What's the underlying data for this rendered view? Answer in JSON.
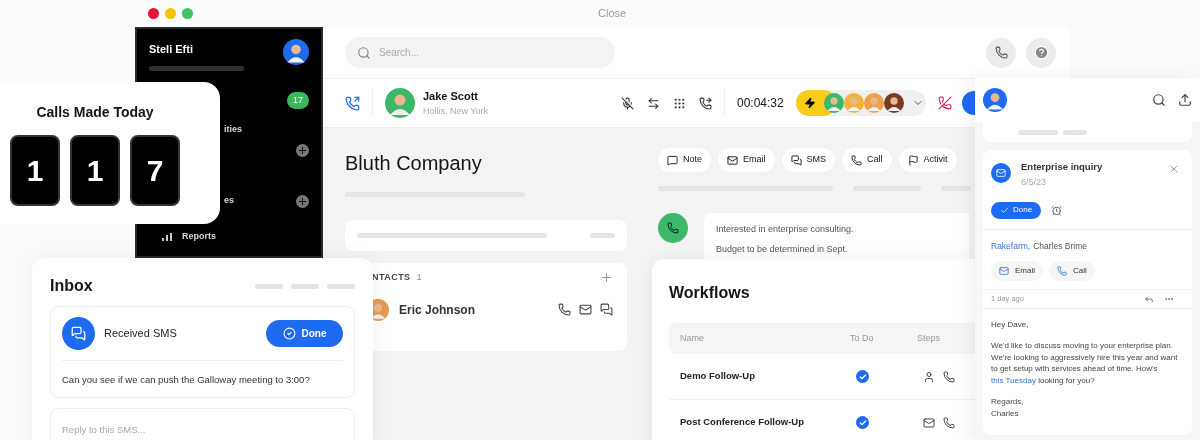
{
  "window": {
    "title": "Close"
  },
  "sidebar": {
    "user": "Steli Efti",
    "badge": "17",
    "items": [
      {
        "label": "ities",
        "kind": "text"
      },
      {
        "label": "es",
        "kind": "text"
      },
      {
        "label": "Reports",
        "kind": "reports"
      }
    ]
  },
  "calls_card": {
    "title": "Calls Made Today",
    "digits": [
      "1",
      "1",
      "7"
    ]
  },
  "search": {
    "placeholder": "Search..."
  },
  "call_bar": {
    "name": "Jake Scott",
    "location": "Hollis, New York",
    "timer": "00:04:32"
  },
  "company": {
    "name": "Bluth Company",
    "actions": [
      {
        "label": "Note",
        "kind": "note"
      },
      {
        "label": "Email",
        "kind": "email"
      },
      {
        "label": "SMS",
        "kind": "sms"
      },
      {
        "label": "Call",
        "kind": "call"
      },
      {
        "label": "Activit",
        "kind": "activity"
      }
    ]
  },
  "timeline": {
    "lines": [
      "Interested in enterprise consulting.",
      "Budget to be determined in Sept."
    ]
  },
  "contacts": {
    "heading": "NTACTS",
    "count": "1",
    "people": [
      {
        "name": "Eric Johnson"
      }
    ]
  },
  "inbox": {
    "title": "Inbox",
    "item": {
      "title": "Received SMS",
      "action": "Done",
      "message": "Can you see if we can push the Galloway meeting to 3:00?"
    },
    "reply": {
      "placeholder": "Reply to this SMS..."
    }
  },
  "workflows": {
    "title": "Workflows",
    "columns": [
      "Name",
      "To Do",
      "Steps"
    ],
    "rows": [
      {
        "name": "Demo Follow-Up",
        "checked": true,
        "steps": [
          {
            "kind": "person"
          },
          {
            "kind": "call"
          }
        ]
      },
      {
        "name": "Post Conference Follow-Up",
        "checked": true,
        "steps": [
          {
            "kind": "email"
          },
          {
            "kind": "call"
          }
        ]
      }
    ]
  },
  "task": {
    "title": "Enterprise inquiry",
    "date": "6/5/23",
    "action": "Done",
    "company": "Rakefarm,",
    "person": "Charles Brime",
    "buttons": [
      {
        "label": "Email",
        "kind": "email"
      },
      {
        "label": "Call",
        "kind": "call"
      }
    ],
    "time": "1 day ago",
    "greeting": "Hey Dave,",
    "body_before": "We'd like to discuss moving to your enterprise plan. We're looking to aggressively hire this year and want to get setup with services ahead of time. How's",
    "link": "this Tuesday",
    "body_after": "looking for you?",
    "sign_off": [
      "Regards,",
      "Charles"
    ]
  }
}
